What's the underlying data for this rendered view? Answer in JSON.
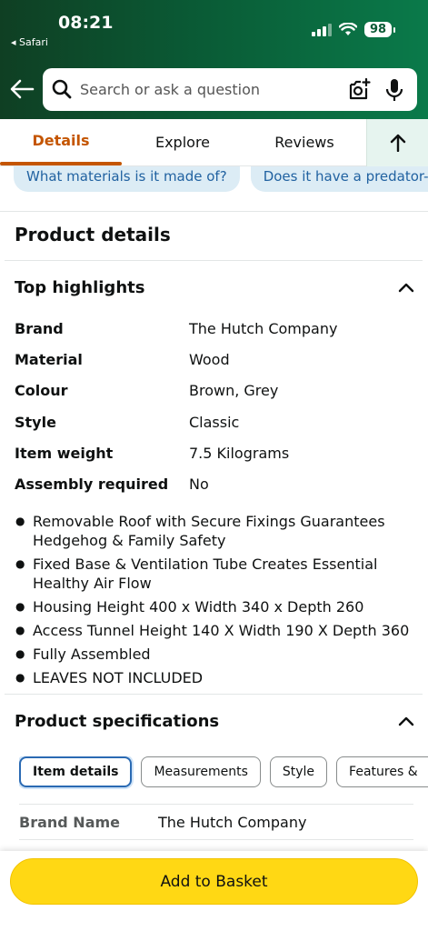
{
  "status_bar": {
    "time": "08:21",
    "back_app": "◂ Safari",
    "battery": "98"
  },
  "search": {
    "placeholder": "Search or ask a question"
  },
  "tabs": [
    {
      "label": "Details",
      "active": true
    },
    {
      "label": "Explore"
    },
    {
      "label": "Reviews"
    }
  ],
  "suggestions": [
    "What materials is it made of?",
    "Does it have a predator-pro"
  ],
  "product_details": {
    "title": "Product details"
  },
  "top_highlights": {
    "title": "Top highlights",
    "rows": [
      {
        "key": "Brand",
        "value": "The Hutch Company"
      },
      {
        "key": "Material",
        "value": "Wood"
      },
      {
        "key": "Colour",
        "value": "Brown, Grey"
      },
      {
        "key": "Style",
        "value": "Classic"
      },
      {
        "key": "Item weight",
        "value": "7.5 Kilograms"
      },
      {
        "key": "Assembly required",
        "value": "No"
      }
    ],
    "bullets": [
      "Removable Roof with Secure Fixings Guarantees Hedgehog & Family Safety",
      "Fixed Base & Ventilation Tube Creates Essential Healthy Air Flow",
      "Housing Height 400 x Width 340 x Depth 260",
      "Access Tunnel Height 140 X Width 190 X Depth 360",
      "Fully Assembled",
      "LEAVES NOT INCLUDED"
    ]
  },
  "product_specifications": {
    "title": "Product specifications",
    "tabs": [
      "Item details",
      "Measurements",
      "Style",
      "Features &"
    ],
    "active_tab": "Item details",
    "rows": [
      {
        "key": "Brand Name",
        "value": "The Hutch Company"
      }
    ]
  },
  "cta": {
    "add_to_basket": "Add to Basket"
  },
  "colors": {
    "accent_tab": "#c45500",
    "button": "#ffd814",
    "link": "#2162a1",
    "header_green": "#0a5a35"
  }
}
